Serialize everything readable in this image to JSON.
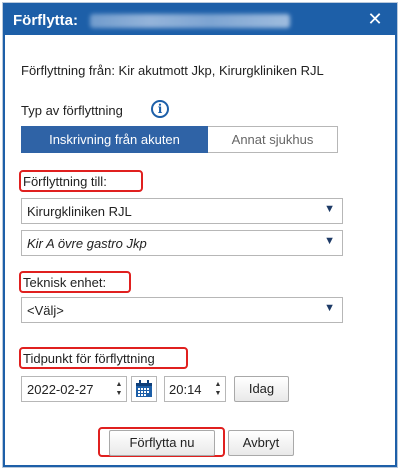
{
  "dialog": {
    "title": "Förflytta:",
    "close_glyph": "✕",
    "from_text": "Förflyttning från: Kir akutmott Jkp, Kirurgkliniken RJL",
    "type_label": "Typ av förflyttning",
    "info_glyph": "i",
    "type_options": [
      "Inskrivning från akuten",
      "Annat sjukhus"
    ],
    "type_selected": "Inskrivning från akuten",
    "to_label": "Förflyttning till:",
    "to_clinic": "Kirurgkliniken RJL",
    "to_unit": "Kir A övre gastro Jkp",
    "tech_label": "Teknisk enhet:",
    "tech_value": "<Välj>",
    "time_label": "Tidpunkt för förflyttning",
    "date_value": "2022-02-27",
    "time_value": "20:14",
    "today_button": "Idag",
    "move_button": "Förflytta nu",
    "cancel_button": "Avbryt",
    "arrow_glyph": "▼"
  },
  "colors": {
    "titlebar": "#1d5fa8",
    "highlight": "#e0201f",
    "segment_active": "#2f63a6"
  }
}
